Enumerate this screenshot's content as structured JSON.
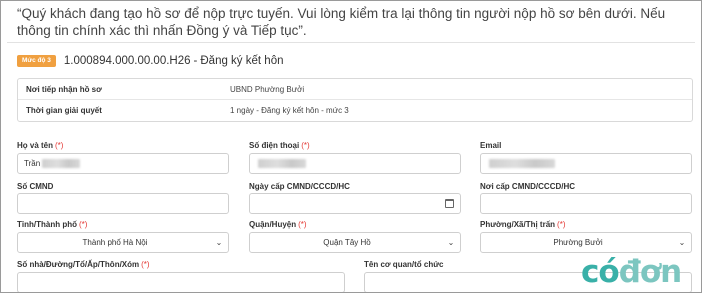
{
  "notice": "“Quý khách đang tạo hồ sơ để nộp trực tuyến. Vui lòng kiểm tra lại thông tin người nộp hồ sơ bên dưới. Nếu thông tin chính xác thì nhấn Đồng ý và Tiếp tục”.",
  "procedure": {
    "level_badge": "Mức độ 3",
    "code": "1.000894.000.00.00.H26",
    "separator": "-",
    "name": "Đăng ký kết hôn"
  },
  "info": {
    "receiver_label": "Nơi tiếp nhận hồ sơ",
    "receiver_value": "UBND Phường Bưởi",
    "duration_label": "Thời gian giải quyết",
    "duration_value": "1 ngày - Đăng ký kết hôn - mức 3"
  },
  "form": {
    "required_mark": "(*)",
    "full_name": {
      "label": "Họ và tên",
      "value": "Trần"
    },
    "phone": {
      "label": "Số điện thoại"
    },
    "email": {
      "label": "Email"
    },
    "id_number": {
      "label": "Số CMND"
    },
    "issue_date": {
      "label": "Ngày cấp CMND/CCCD/HC"
    },
    "issue_place": {
      "label": "Nơi cấp CMND/CCCD/HC"
    },
    "province": {
      "label": "Tỉnh/Thành phố",
      "value": "Thành phố Hà Nội"
    },
    "district": {
      "label": "Quận/Huyện",
      "value": "Quận Tây Hồ"
    },
    "ward": {
      "label": "Phường/Xã/Thị trấn",
      "value": "Phường Bưởi"
    },
    "address": {
      "label": "Số nhà/Đường/Tổ/Ấp/Thôn/Xóm"
    },
    "organization": {
      "label": "Tên cơ quan/tổ chức"
    }
  },
  "watermark": {
    "part1": "có",
    "part2": "đơn"
  },
  "colors": {
    "badge": "#f0a040",
    "required": "#e53935",
    "logo": "#39b0a8"
  }
}
